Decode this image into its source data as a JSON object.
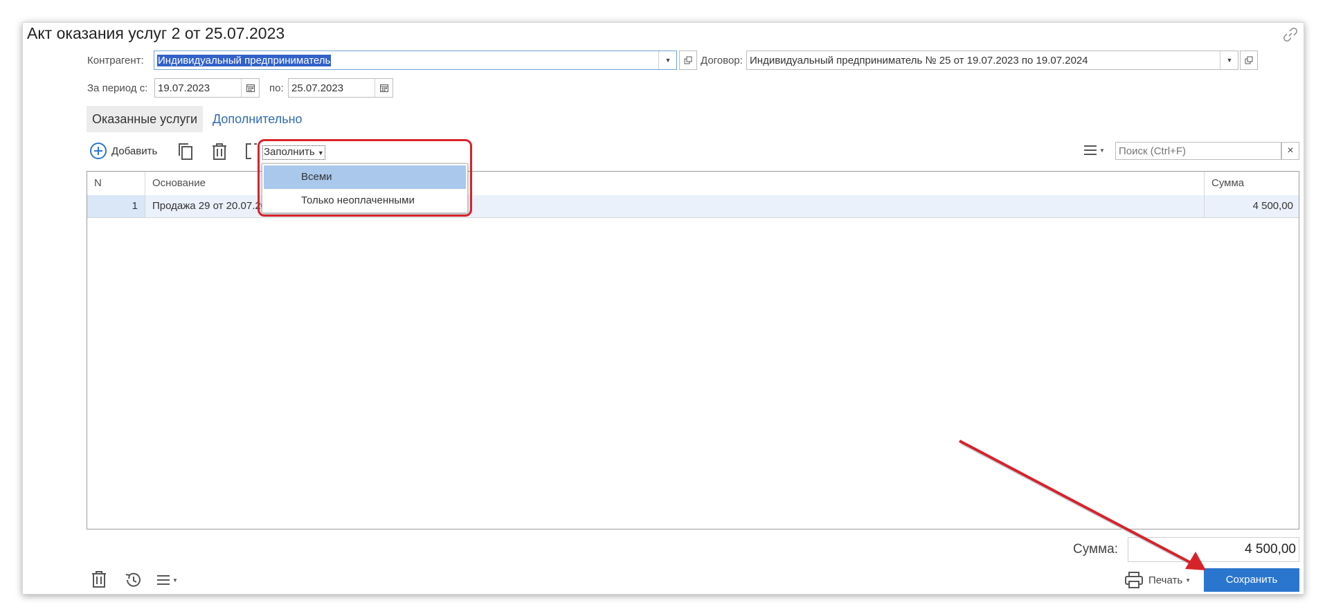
{
  "window": {
    "title": "Акт оказания услуг 2 от 25.07.2023"
  },
  "header": {
    "counterparty_label": "Контрагент:",
    "counterparty_value": "Индивидуальный предприниматель",
    "contract_label": "Договор:",
    "contract_value": "Индивидуальный предприниматель № 25 от 19.07.2023 по 19.07.2024",
    "period_from_label": "За период с:",
    "period_from_value": "19.07.2023",
    "period_to_label": "по:",
    "period_to_value": "25.07.2023"
  },
  "tabs": [
    {
      "label": "Оказанные услуги",
      "active": true
    },
    {
      "label": "Дополнительно",
      "active": false
    }
  ],
  "toolbar": {
    "add_label": "Добавить",
    "fill_label": "Заполнить",
    "search_placeholder": "Поиск (Ctrl+F)",
    "search_clear": "×"
  },
  "fill_menu": {
    "items": [
      {
        "label": "Всеми",
        "highlighted": true
      },
      {
        "label": "Только неоплаченными",
        "highlighted": false
      }
    ]
  },
  "table": {
    "columns": [
      "N",
      "Основание",
      "Сумма"
    ],
    "rows": [
      {
        "n": "1",
        "basis": "Продажа 29 от 20.07.2023",
        "amount": "4 500,00"
      }
    ]
  },
  "footer": {
    "sum_label": "Сумма:",
    "sum_value": "4 500,00",
    "print_label": "Печать",
    "save_label": "Сохранить"
  },
  "colors": {
    "accent": "#2a76cf",
    "selection": "#3161c9",
    "highlight": "#a9c8ec",
    "annotation": "#d8222a",
    "link": "#2f6bb4"
  }
}
